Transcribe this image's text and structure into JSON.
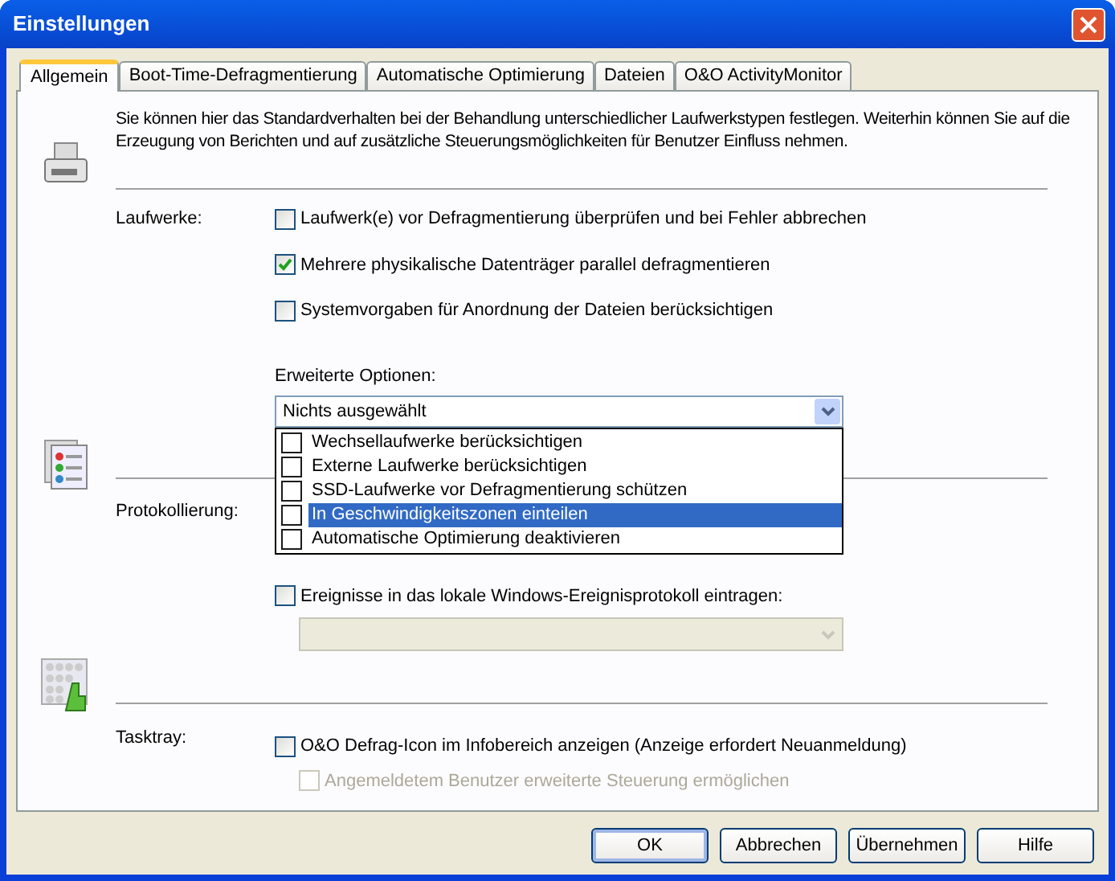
{
  "window": {
    "title": "Einstellungen"
  },
  "tabs": [
    {
      "label": "Allgemein",
      "selected": true
    },
    {
      "label": "Boot-Time-Defragmentierung",
      "selected": false
    },
    {
      "label": "Automatische Optimierung",
      "selected": false
    },
    {
      "label": "Dateien",
      "selected": false
    },
    {
      "label": "O&O ActivityMonitor",
      "selected": false
    }
  ],
  "description": "Sie können hier das Standardverhalten bei der Behandlung unterschiedlicher Laufwerkstypen festlegen. Weiterhin können Sie auf die Erzeugung von Berichten und auf zusätzliche Steuerungsmöglichkeiten für Benutzer Einfluss nehmen.",
  "drives": {
    "label": "Laufwerke:",
    "options": [
      {
        "label": "Laufwerk(e) vor Defragmentierung überprüfen und bei Fehler abbrechen",
        "checked": false
      },
      {
        "label": "Mehrere physikalische Datenträger parallel defragmentieren",
        "checked": true
      },
      {
        "label": "Systemvorgaben für Anordnung der Dateien berücksichtigen",
        "checked": false
      }
    ],
    "advanced": {
      "label": "Erweiterte Optionen:",
      "value": "Nichts ausgewählt",
      "expanded": true,
      "items": [
        {
          "label": "Wechsellaufwerke berücksichtigen",
          "checked": false,
          "selected": false
        },
        {
          "label": "Externe Laufwerke berücksichtigen",
          "checked": false,
          "selected": false
        },
        {
          "label": "SSD-Laufwerke vor Defragmentierung schützen",
          "checked": false,
          "selected": false
        },
        {
          "label": "In Geschwindigkeitszonen einteilen",
          "checked": false,
          "selected": true
        },
        {
          "label": "Automatische Optimierung deaktivieren",
          "checked": false,
          "selected": false
        }
      ]
    }
  },
  "logging": {
    "label": "Protokollierung:",
    "event_log": {
      "label": "Ereignisse in das lokale Windows-Ereignisprotokoll eintragen:",
      "checked": false
    },
    "event_source": {
      "disabled": true
    }
  },
  "tasktray": {
    "label": "Tasktray:",
    "options": [
      {
        "label": "O&O Defrag-Icon im Infobereich anzeigen (Anzeige erfordert Neuanmeldung)",
        "checked": false,
        "disabled": false
      },
      {
        "label": "Angemeldetem Benutzer erweiterte Steuerung ermöglichen",
        "checked": false,
        "disabled": true
      }
    ]
  },
  "buttons": [
    {
      "label": "OK",
      "default": true
    },
    {
      "label": "Abbrechen",
      "default": false
    },
    {
      "label": "Übernehmen",
      "default": false
    },
    {
      "label": "Hilfe",
      "default": false
    }
  ]
}
